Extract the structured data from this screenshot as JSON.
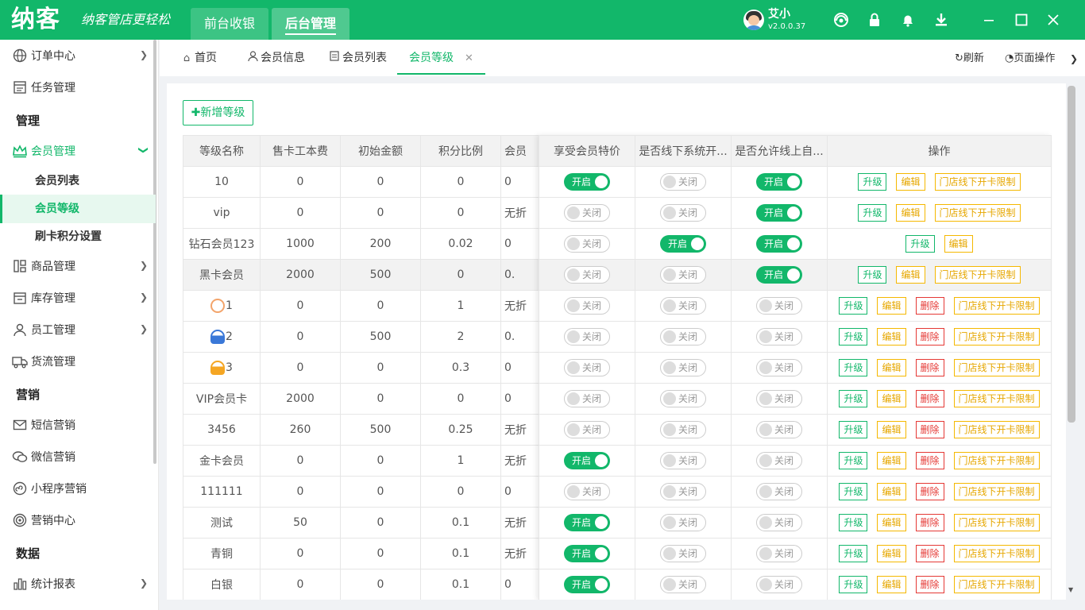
{
  "app": {
    "logo": "纳客",
    "slogan": "纳客管店更轻松",
    "nav": [
      "前台收银",
      "后台管理"
    ],
    "user": "艾小",
    "version": "v2.0.0.37"
  },
  "sidebar": {
    "items": [
      {
        "label": "订单中心",
        "icon": "globe-icon"
      },
      {
        "label": "任务管理",
        "icon": "task-icon"
      },
      {
        "section": "管理"
      },
      {
        "label": "会员管理",
        "icon": "crown-icon"
      },
      {
        "sub": "会员列表"
      },
      {
        "sub": "会员等级"
      },
      {
        "sub": "刷卡积分设置"
      },
      {
        "label": "商品管理",
        "icon": "goods-icon"
      },
      {
        "label": "库存管理",
        "icon": "inventory-icon"
      },
      {
        "label": "员工管理",
        "icon": "user-icon"
      },
      {
        "label": "货流管理",
        "icon": "truck-icon"
      },
      {
        "section": "营销"
      },
      {
        "label": "短信营销",
        "icon": "mail-icon"
      },
      {
        "label": "微信营销",
        "icon": "wechat-icon"
      },
      {
        "label": "小程序营销",
        "icon": "miniprogram-icon"
      },
      {
        "label": "营销中心",
        "icon": "target-icon"
      },
      {
        "section": "数据"
      },
      {
        "label": "统计报表",
        "icon": "chart-icon"
      }
    ]
  },
  "tabs": [
    {
      "label": "首页",
      "icon": "home-icon"
    },
    {
      "label": "会员信息",
      "icon": "user-icon"
    },
    {
      "label": "会员列表",
      "icon": "list-icon"
    },
    {
      "label": "会员等级",
      "active": true
    }
  ],
  "tools": {
    "refresh": "刷新",
    "page_ops": "页面操作"
  },
  "add_button": "✚新增等级",
  "table": {
    "headers_left": [
      "等级名称",
      "售卡工本费",
      "初始金额",
      "积分比例",
      "会员"
    ],
    "headers_right": [
      "享受会员特价",
      "是否线下系统开...",
      "是否允许线上自...",
      "操作"
    ],
    "switch_on": "开启",
    "switch_off": "关闭",
    "actions": {
      "upgrade": "升级",
      "edit": "编辑",
      "delete": "删除",
      "limit": "门店线下开卡限制"
    },
    "rows": [
      {
        "name": "10",
        "fee": "0",
        "init": "0",
        "ratio": "0",
        "disc": "0",
        "s1": true,
        "s2": false,
        "s3": true,
        "ops": [
          "upgrade",
          "edit",
          "limit"
        ]
      },
      {
        "name": "vip",
        "fee": "0",
        "init": "0",
        "ratio": "0",
        "disc": "无折",
        "s1": false,
        "s2": false,
        "s3": true,
        "ops": [
          "upgrade",
          "edit",
          "limit"
        ]
      },
      {
        "name": "钻石会员123",
        "fee": "1000",
        "init": "200",
        "ratio": "0.02",
        "disc": "0",
        "s1": false,
        "s2": true,
        "s3": true,
        "ops": [
          "upgrade",
          "edit"
        ]
      },
      {
        "name": "黑卡会员",
        "fee": "2000",
        "init": "500",
        "ratio": "0",
        "disc": "0.",
        "s1": false,
        "s2": false,
        "s3": true,
        "ops": [
          "upgrade",
          "edit",
          "limit"
        ],
        "hl": true
      },
      {
        "name": "1",
        "icon": "lv1",
        "fee": "0",
        "init": "0",
        "ratio": "1",
        "disc": "无折",
        "s1": false,
        "s2": false,
        "s3": false,
        "ops": [
          "upgrade",
          "edit",
          "delete",
          "limit"
        ]
      },
      {
        "name": "2",
        "icon": "lv2",
        "fee": "0",
        "init": "500",
        "ratio": "2",
        "disc": "0.",
        "s1": false,
        "s2": false,
        "s3": false,
        "ops": [
          "upgrade",
          "edit",
          "delete",
          "limit"
        ]
      },
      {
        "name": "3",
        "icon": "lv3",
        "fee": "0",
        "init": "0",
        "ratio": "0.3",
        "disc": "0",
        "s1": false,
        "s2": false,
        "s3": false,
        "ops": [
          "upgrade",
          "edit",
          "delete",
          "limit"
        ]
      },
      {
        "name": "VIP会员卡",
        "fee": "2000",
        "init": "0",
        "ratio": "0",
        "disc": "0",
        "s1": false,
        "s2": false,
        "s3": false,
        "ops": [
          "upgrade",
          "edit",
          "delete",
          "limit"
        ]
      },
      {
        "name": "3456",
        "fee": "260",
        "init": "500",
        "ratio": "0.25",
        "disc": "无折",
        "s1": false,
        "s2": false,
        "s3": false,
        "ops": [
          "upgrade",
          "edit",
          "delete",
          "limit"
        ]
      },
      {
        "name": "金卡会员",
        "fee": "0",
        "init": "0",
        "ratio": "1",
        "disc": "无折",
        "s1": true,
        "s2": false,
        "s3": false,
        "ops": [
          "upgrade",
          "edit",
          "delete",
          "limit"
        ]
      },
      {
        "name": "111111",
        "fee": "0",
        "init": "0",
        "ratio": "0",
        "disc": "0",
        "s1": false,
        "s2": false,
        "s3": false,
        "ops": [
          "upgrade",
          "edit",
          "delete",
          "limit"
        ]
      },
      {
        "name": "测试",
        "fee": "50",
        "init": "0",
        "ratio": "0.1",
        "disc": "无折",
        "s1": true,
        "s2": false,
        "s3": false,
        "ops": [
          "upgrade",
          "edit",
          "delete",
          "limit"
        ]
      },
      {
        "name": "青铜",
        "fee": "0",
        "init": "0",
        "ratio": "0.1",
        "disc": "无折",
        "s1": true,
        "s2": false,
        "s3": false,
        "ops": [
          "upgrade",
          "edit",
          "delete",
          "limit"
        ]
      },
      {
        "name": "白银",
        "fee": "0",
        "init": "0",
        "ratio": "0.1",
        "disc": "0",
        "s1": true,
        "s2": false,
        "s3": false,
        "ops": [
          "upgrade",
          "edit",
          "delete",
          "limit"
        ]
      }
    ]
  },
  "colors": {
    "brand": "#12b76a",
    "warn": "#f5b800",
    "danger": "#e53935"
  }
}
